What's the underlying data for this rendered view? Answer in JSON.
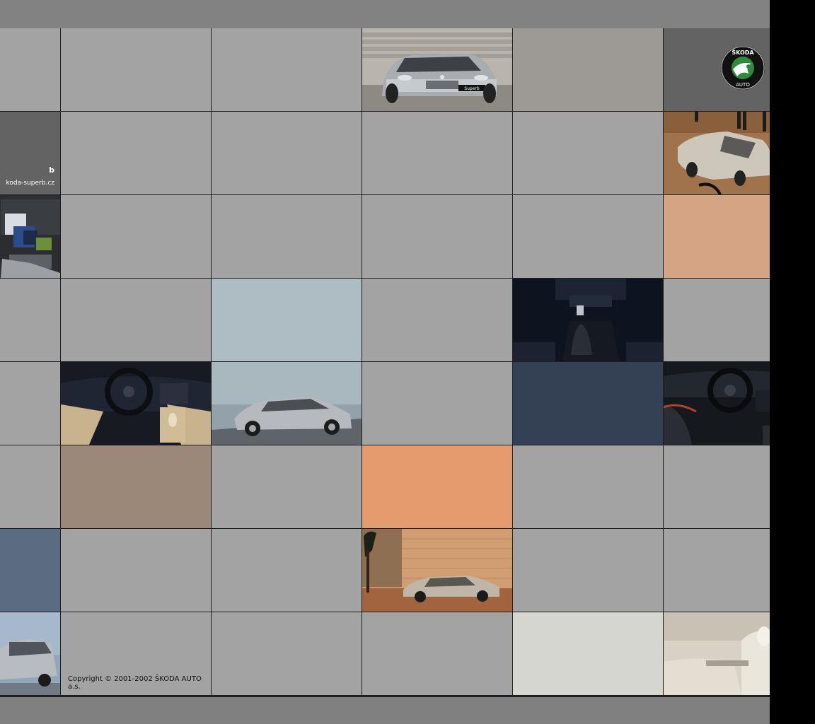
{
  "brand": {
    "logo_top": "ŠKODA",
    "logo_bottom": "AUTO"
  },
  "site": {
    "name_fragment": "b",
    "url_fragment": "koda-superb.cz"
  },
  "car": {
    "plate": "Superb"
  },
  "footer": {
    "copyright": "Copyright © 2001-2002 ŠKODA AUTO a.s."
  },
  "colors": {
    "tile_gray": "#a3a3a3",
    "top_bar": "#828282",
    "bottom_bar": "#808080",
    "grid_line": "#1e1e1e",
    "brand_green": "#2e8b3e"
  }
}
